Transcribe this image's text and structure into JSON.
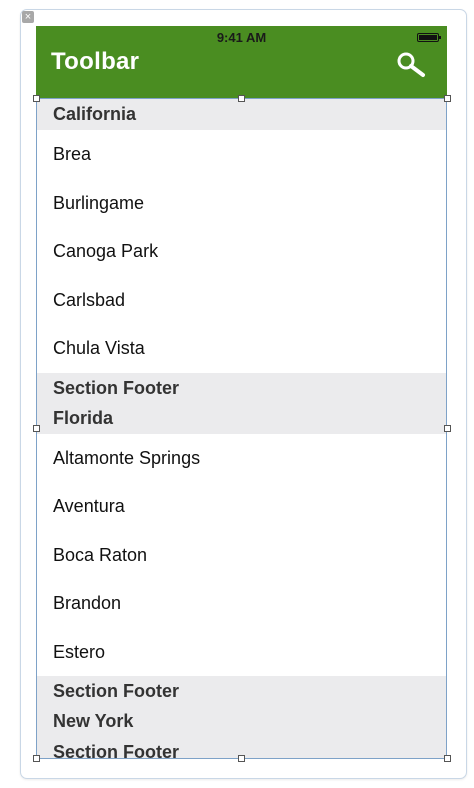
{
  "status_bar": {
    "time": "9:41 AM"
  },
  "toolbar": {
    "title": "Toolbar",
    "search_icon": "search-icon"
  },
  "sections": [
    {
      "header": "California",
      "items": [
        "Brea",
        "Burlingame",
        "Canoga Park",
        "Carlsbad",
        "Chula Vista"
      ],
      "footer": "Section Footer"
    },
    {
      "header": "Florida",
      "items": [
        "Altamonte Springs",
        "Aventura",
        "Boca Raton",
        "Brandon",
        "Estero"
      ],
      "footer": "Section Footer"
    },
    {
      "header": "New York",
      "items": [],
      "footer": "Section Footer"
    }
  ],
  "colors": {
    "toolbar": "#4a8d21",
    "section_bg": "#ebebed",
    "selection": "#7ea2c8"
  }
}
